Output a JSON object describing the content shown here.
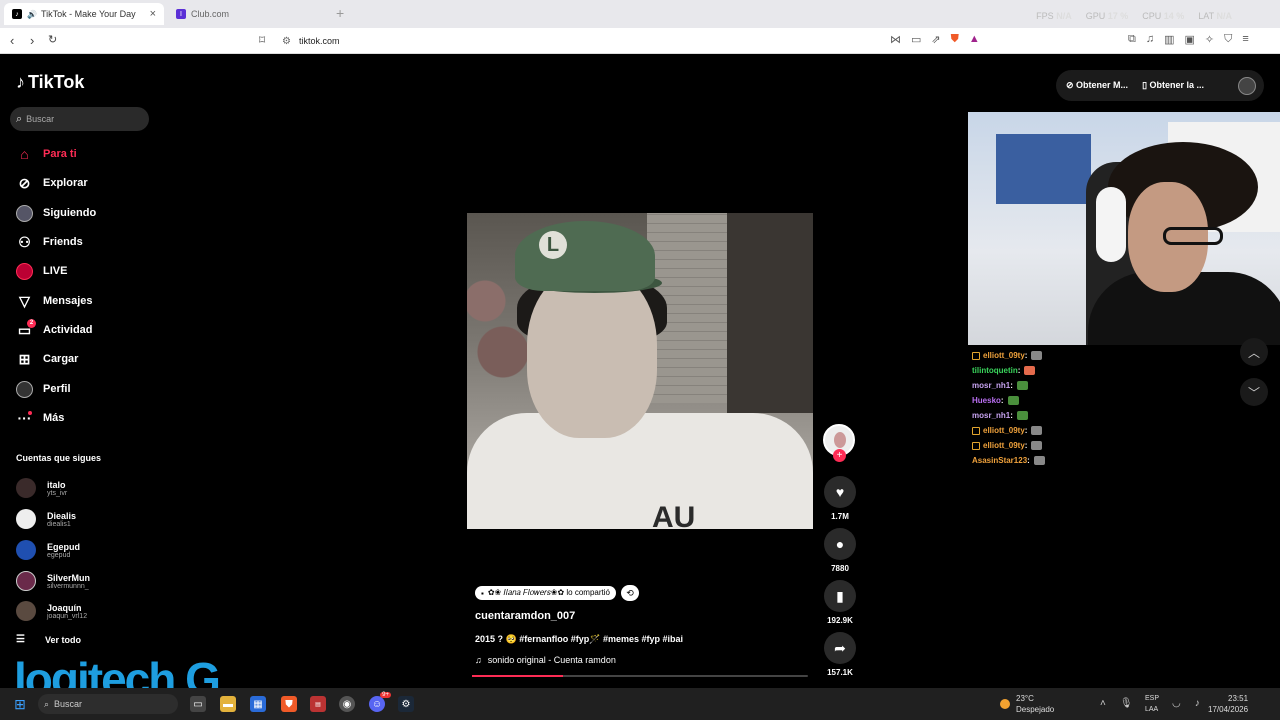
{
  "browser": {
    "tabs": [
      {
        "label": "TikTok - Make Your Day"
      },
      {
        "label": "Club.com"
      }
    ],
    "url": "tiktok.com",
    "stats": {
      "fps_label": "FPS",
      "fps_value": "N/A",
      "gpu_label": "GPU",
      "gpu_value": "17 %",
      "cpu_label": "CPU",
      "cpu_value": "14 %",
      "lat_label": "LAT",
      "lat_value": "N/A"
    }
  },
  "app": {
    "logo": "TikTok",
    "search_placeholder": "Buscar"
  },
  "sidebar": {
    "items": [
      {
        "label": "Para ti",
        "icon": "home-icon"
      },
      {
        "label": "Explorar",
        "icon": "compass-icon"
      },
      {
        "label": "Siguiendo",
        "icon": "avatar"
      },
      {
        "label": "Friends",
        "icon": "friends-icon"
      },
      {
        "label": "LIVE",
        "icon": "live-icon"
      },
      {
        "label": "Mensajes",
        "icon": "paper-plane-icon"
      },
      {
        "label": "Actividad",
        "icon": "activity-icon",
        "badge": "2"
      },
      {
        "label": "Cargar",
        "icon": "upload-icon"
      },
      {
        "label": "Perfil",
        "icon": "avatar"
      },
      {
        "label": "Más",
        "icon": "more-icon"
      }
    ],
    "following_title": "Cuentas que sigues",
    "accounts": [
      {
        "name": "italo",
        "handle": "yts_ivr"
      },
      {
        "name": "Diealis",
        "handle": "diealis1"
      },
      {
        "name": "Egepud",
        "handle": "egepud"
      },
      {
        "name": "SilverMun",
        "handle": "silvermunnn_"
      },
      {
        "name": "Joaquín",
        "handle": "joaqun_vrl12"
      }
    ],
    "see_all": "Ver todo",
    "watermark": "logitech G"
  },
  "topbar": {
    "btn1": "Obtener M...",
    "btn2": "Obtener la ..."
  },
  "video": {
    "cap_letter": "L",
    "shirt_text": "AU",
    "repost_text": "✿❀ 𝐼𝑙𝑎𝑛𝑎 𝐹𝑙𝑜𝑤𝑒𝑟𝑠❀✿ lo compartió",
    "username": "cuentaramdon_007",
    "description": "2015 ? 🥺 #fernanfloo #fyp🪄 #memes #fyp #ibai",
    "sound": "sonido original - Cuenta ramdon",
    "progress": 0.27,
    "likes": "1.7M",
    "comments": "7880",
    "saves": "192.9K",
    "shares": "157.1K"
  },
  "chat": [
    {
      "user": "elliott_09ty",
      "color": "#f0a23c",
      "tag": true,
      "emote": "#888"
    },
    {
      "user": "tilintoquetin",
      "color": "#3ad55c",
      "tag": false,
      "emote": "#e46a4c"
    },
    {
      "user": "mosr_nh1",
      "color": "#c7a3f0",
      "tag": false,
      "emote": "#4a8f3c"
    },
    {
      "user": "Huesko",
      "color": "#b86ef0",
      "tag": false,
      "emote": "#4a8f3c"
    },
    {
      "user": "mosr_nh1",
      "color": "#c7a3f0",
      "tag": false,
      "emote": "#4a8f3c"
    },
    {
      "user": "elliott_09ty",
      "color": "#f0a23c",
      "tag": true,
      "emote": "#888"
    },
    {
      "user": "elliott_09ty",
      "color": "#f0a23c",
      "tag": true,
      "emote": "#888"
    },
    {
      "user": "AsasinStar123",
      "color": "#f0a23c",
      "tag": false,
      "emote": "#888"
    }
  ],
  "taskbar": {
    "search": "Buscar",
    "discord_badge": "9+",
    "weather_temp": "23°C",
    "weather_desc": "Despejado",
    "lang1": "ESP",
    "lang2": "LAA",
    "time": "23:51",
    "date": "17/04/2026"
  },
  "colors": {
    "accent": "#fe2c55",
    "logitech": "#1e9ee0"
  }
}
